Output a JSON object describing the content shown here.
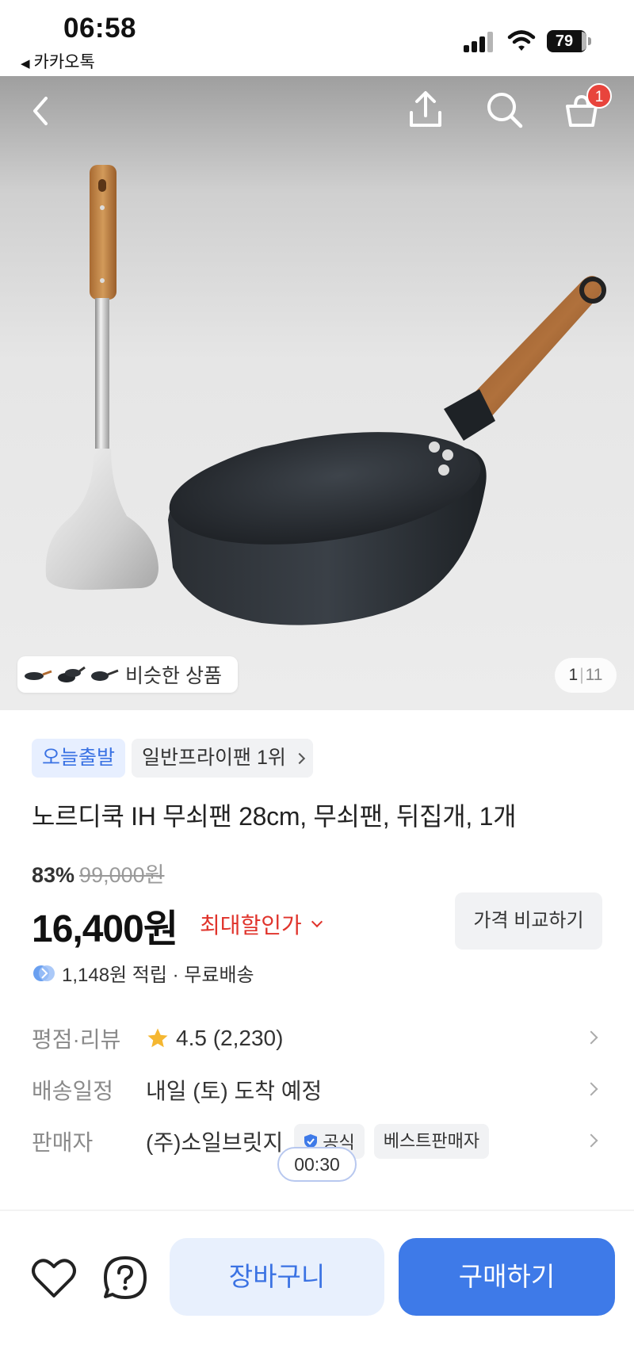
{
  "status_bar": {
    "time": "06:58",
    "back_app": "카카오톡",
    "battery": "79"
  },
  "header": {
    "cart_count": "1",
    "icons": [
      "back-icon",
      "share-icon",
      "search-icon",
      "cart-icon"
    ]
  },
  "gallery": {
    "similar_label": "비슷한 상품",
    "current": "1",
    "separator": "|",
    "total": "11"
  },
  "product": {
    "chip_delivery": "오늘출발",
    "chip_rank": "일반프라이팬 1위",
    "title": "노르디쿡 IH 무쇠팬 28cm, 무쇠팬, 뒤집개, 1개",
    "discount_pct": "83%",
    "original_price": "99,000원",
    "price": "16,400원",
    "max_discount_label": "최대할인가",
    "compare_label": "가격 비교하기",
    "points": "1,148원 적립 · 무료배송"
  },
  "info": {
    "rating_key": "평점·리뷰",
    "rating": "4.5 (2,230)",
    "shipping_key": "배송일정",
    "shipping": "내일 (토) 도착 예정",
    "seller_key": "판매자",
    "seller": "(주)소일브릿지",
    "badge_official": "공식",
    "badge_best": "베스트판매자"
  },
  "timer": "00:30",
  "bottom_bar": {
    "cart_label": "장바구니",
    "buy_label": "구매하기"
  },
  "colors": {
    "accent_blue": "#3e7ae8",
    "discount_red": "#e0332b",
    "badge_red": "#e8443c"
  }
}
